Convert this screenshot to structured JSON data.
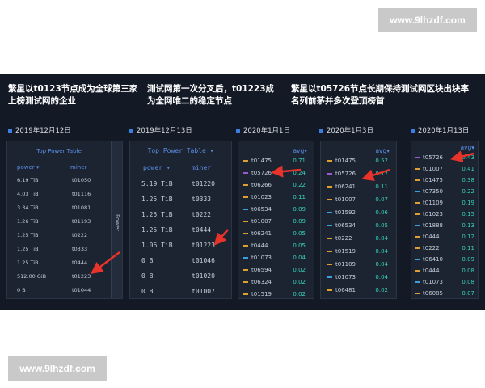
{
  "watermark": "www.9lhzdf.com",
  "headlines": [
    "繁星以t0123节点成为全球第三家上榜测试网的企业",
    "测试网第一次分叉后，t01223成为全网唯二的稳定节点",
    "繁星以t05726节点长期保持测试网区块出块率名列前茅并多次登顶榜首"
  ],
  "dates": [
    "2019年12月12日",
    "2019年12月13日",
    "2020年1月1日",
    "2020年1月3日",
    "2020年1月13日"
  ],
  "colors": {
    "accent_blue": "#3b7ee0",
    "arrow_red": "#e8332b",
    "avg_teal": "#38d0b9"
  },
  "card1": {
    "title": "Top Power Table",
    "col_power": "power ▾",
    "col_miner": "miner",
    "side_label": "Power",
    "rows": [
      {
        "power": "6.19 TiB",
        "miner": "t01050"
      },
      {
        "power": "4.03 TiB",
        "miner": "t01116"
      },
      {
        "power": "3.34 TiB",
        "miner": "t01081"
      },
      {
        "power": "1.26 TiB",
        "miner": "t01193"
      },
      {
        "power": "1.25 TiB",
        "miner": "t0222"
      },
      {
        "power": "1.25 TiB",
        "miner": "t0333"
      },
      {
        "power": "1.25 TiB",
        "miner": "t0444"
      },
      {
        "power": "512.00 GiB",
        "miner": "t01223"
      },
      {
        "power": "0 B",
        "miner": "t01044"
      }
    ]
  },
  "card2": {
    "title": "Top Power Table ▾",
    "col_power": "power ▾",
    "col_miner": "miner",
    "rows": [
      {
        "power": "5.19 TiB",
        "miner": "t01220"
      },
      {
        "power": "1.25 TiB",
        "miner": "t0333"
      },
      {
        "power": "1.25 TiB",
        "miner": "t0222"
      },
      {
        "power": "1.25 TiB",
        "miner": "t0444"
      },
      {
        "power": "1.06 TiB",
        "miner": "t01223"
      },
      {
        "power": "0 B",
        "miner": "t01046"
      },
      {
        "power": "0 B",
        "miner": "t01020"
      },
      {
        "power": "0 B",
        "miner": "t01007"
      }
    ]
  },
  "card3": {
    "avg_label": "avg▾",
    "rows": [
      {
        "id": "t01475",
        "avg": "0.71",
        "color": "#e0a030"
      },
      {
        "id": "t05726",
        "avg": "0.24",
        "color": "#9b59d0"
      },
      {
        "id": "t06266",
        "avg": "0.22",
        "color": "#e0a030"
      },
      {
        "id": "t01023",
        "avg": "0.11",
        "color": "#e0a030"
      },
      {
        "id": "t06534",
        "avg": "0.09",
        "color": "#3aa0e0"
      },
      {
        "id": "t01007",
        "avg": "0.09",
        "color": "#e0a030"
      },
      {
        "id": "t06241",
        "avg": "0.05",
        "color": "#e0a030"
      },
      {
        "id": "t0444",
        "avg": "0.05",
        "color": "#e0a030"
      },
      {
        "id": "t01073",
        "avg": "0.04",
        "color": "#3aa0e0"
      },
      {
        "id": "t06594",
        "avg": "0.02",
        "color": "#e0a030"
      },
      {
        "id": "t06324",
        "avg": "0.02",
        "color": "#e0a030"
      },
      {
        "id": "t01519",
        "avg": "0.02",
        "color": "#e0a030"
      }
    ]
  },
  "card4": {
    "avg_label": "avg▾",
    "rows": [
      {
        "id": "t01475",
        "avg": "0.52",
        "color": "#e0a030"
      },
      {
        "id": "t05726",
        "avg": "0.17",
        "color": "#9b59d0"
      },
      {
        "id": "t06241",
        "avg": "0.11",
        "color": "#e0a030"
      },
      {
        "id": "t01007",
        "avg": "0.07",
        "color": "#e0a030"
      },
      {
        "id": "t01592",
        "avg": "0.06",
        "color": "#3aa0e0"
      },
      {
        "id": "t06534",
        "avg": "0.05",
        "color": "#3aa0e0"
      },
      {
        "id": "t0222",
        "avg": "0.04",
        "color": "#e0a030"
      },
      {
        "id": "t01519",
        "avg": "0.04",
        "color": "#e0a030"
      },
      {
        "id": "t01109",
        "avg": "0.04",
        "color": "#e0a030"
      },
      {
        "id": "t01073",
        "avg": "0.04",
        "color": "#3aa0e0"
      },
      {
        "id": "t06481",
        "avg": "0.02",
        "color": "#e0a030"
      }
    ]
  },
  "card5": {
    "avg_label": "avg▾",
    "rows": [
      {
        "id": "t05726",
        "avg": "0.43",
        "color": "#9b59d0"
      },
      {
        "id": "t01007",
        "avg": "0.41",
        "color": "#e0a030"
      },
      {
        "id": "t01475",
        "avg": "0.38",
        "color": "#e0a030"
      },
      {
        "id": "t07350",
        "avg": "0.22",
        "color": "#3aa0e0"
      },
      {
        "id": "t01109",
        "avg": "0.19",
        "color": "#e0a030"
      },
      {
        "id": "t01023",
        "avg": "0.15",
        "color": "#e0a030"
      },
      {
        "id": "t01888",
        "avg": "0.13",
        "color": "#3aa0e0"
      },
      {
        "id": "t0444",
        "avg": "0.12",
        "color": "#e0a030"
      },
      {
        "id": "t0222",
        "avg": "0.11",
        "color": "#e0a030"
      },
      {
        "id": "t06410",
        "avg": "0.09",
        "color": "#3aa0e0"
      },
      {
        "id": "t0444",
        "avg": "0.08",
        "color": "#e0a030"
      },
      {
        "id": "t01073",
        "avg": "0.08",
        "color": "#3aa0e0"
      },
      {
        "id": "t06085",
        "avg": "0.07",
        "color": "#e0a030"
      }
    ]
  }
}
